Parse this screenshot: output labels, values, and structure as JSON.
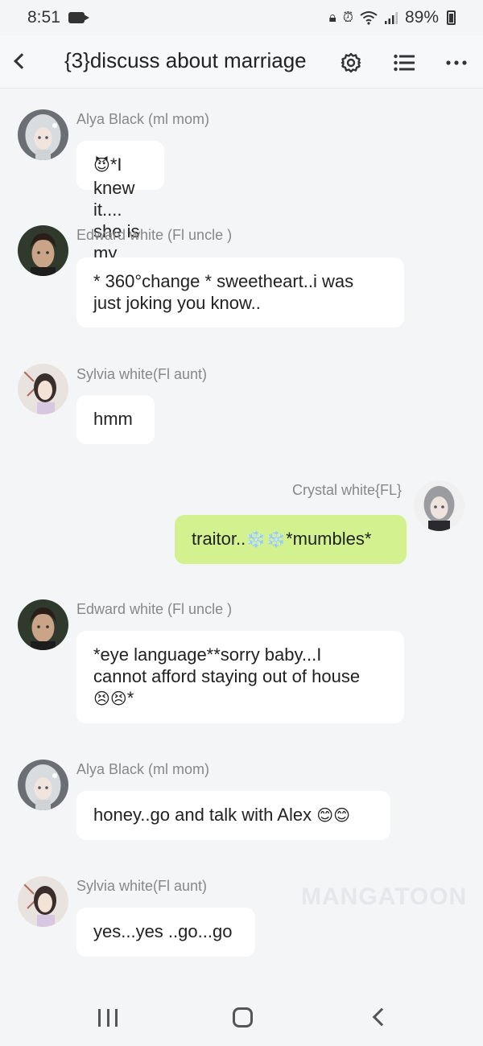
{
  "status_bar": {
    "time": "8:51",
    "battery": "89%",
    "icons": [
      "video-camera-icon",
      "lock-icon",
      "alarm-icon",
      "wifi-icon",
      "signal-icon",
      "battery-icon"
    ]
  },
  "header": {
    "title": "{3}discuss about marriage",
    "icons": [
      "back-icon",
      "gear-icon",
      "list-icon",
      "more-icon"
    ]
  },
  "messages": [
    {
      "sender": "Alya Black  (ml mom)",
      "text": "*I knew it.... she is my bestie*",
      "emoji_prefix": "😈",
      "mine": false,
      "avatar": "alya-avatar"
    },
    {
      "sender": "Edward white  (Fl uncle )",
      "lines": [
        "* 360°change * sweetheart..i was",
        "just joking you know.."
      ],
      "mine": false,
      "avatar": "edward-avatar"
    },
    {
      "sender": "Sylvia white(Fl aunt)",
      "text": "hmm",
      "mine": false,
      "avatar": "sylvia-avatar"
    },
    {
      "sender": "Crystal white{FL}",
      "text_pre": "traitor..",
      "text_emoji": "❄️❄️",
      "text_post": "*mumbles*",
      "mine": true,
      "avatar": "crystal-avatar"
    },
    {
      "sender": "Edward white  (Fl uncle )",
      "lines": [
        "*eye language**sorry baby...I",
        "cannot afford staying out of house"
      ],
      "line3_emoji": "😣😣",
      "line3_text": "*",
      "mine": false,
      "avatar": "edward-avatar"
    },
    {
      "sender": "Alya Black  (ml mom)",
      "text": "honey..go and talk with Alex ",
      "emoji_suffix": "😊😊",
      "mine": false,
      "avatar": "alya-avatar"
    },
    {
      "sender": "Sylvia white(Fl aunt)",
      "text": "yes...yes ..go...go",
      "mine": false,
      "avatar": "sylvia-avatar"
    }
  ],
  "watermark": "MANGATOON",
  "colors": {
    "background": "#f4f5f7",
    "bubble_other": "#ffffff",
    "bubble_mine": "#d3f18e",
    "sender_text": "#888888"
  }
}
